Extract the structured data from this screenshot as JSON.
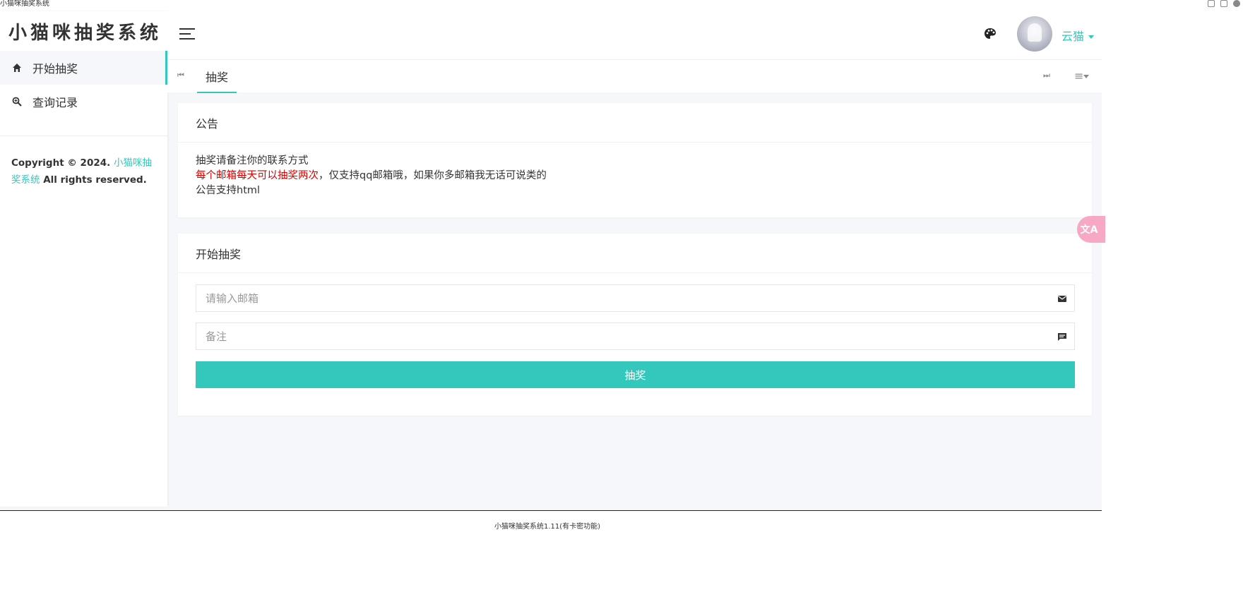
{
  "window": {
    "title": "小猫咪抽奖系统"
  },
  "sidebar": {
    "brand": "小猫咪抽奖系统",
    "items": [
      {
        "label": "开始抽奖",
        "icon": "home-icon",
        "active": true
      },
      {
        "label": "查询记录",
        "icon": "search-icon",
        "active": false
      }
    ],
    "copyright": {
      "prefix": "Copyright © 2024. ",
      "link": "小猫咪抽奖系统",
      "suffix": " All rights reserved."
    }
  },
  "header": {
    "username": "云猫",
    "palette_icon": "palette-icon",
    "menu_icon": "hamburger-icon"
  },
  "tabs": {
    "scroll_left": "⏮",
    "scroll_right": "⏭",
    "menu": "≡",
    "items": [
      {
        "label": "抽奖"
      }
    ]
  },
  "notice": {
    "title": "公告",
    "line1": "抽奖请备注你的联系方式",
    "line2_red": "每个邮箱每天可以抽奖两次",
    "line2_rest": "，仅支持qq邮箱哦，如果你多邮箱我无话可说类的",
    "line3": "公告支持html"
  },
  "lottery": {
    "title": "开始抽奖",
    "email_placeholder": "请输入邮箱",
    "remark_placeholder": "备注",
    "submit_label": "抽奖"
  },
  "translate_fab": {
    "label": "文A"
  },
  "footer": {
    "text": "小猫咪抽奖系统1.11(有卡密功能)"
  },
  "colors": {
    "accent": "#34c8bc",
    "notice_red": "#dd0000"
  }
}
